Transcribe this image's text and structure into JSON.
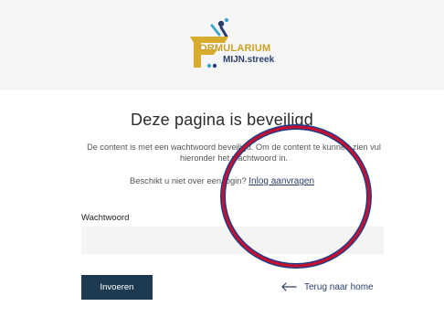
{
  "header": {
    "logo": {
      "icon": "formularium-mascot-logo-icon",
      "line1": "ORMULARIUM",
      "line2": "MIJN.streek"
    }
  },
  "main": {
    "title": "Deze pagina is beveiligd",
    "intro": "De content is met een wachtwoord beveiligd. Om de content te kunnen zien vul hieronder het wachtwoord in.",
    "login_prompt": "Beschikt u niet over een login?",
    "login_link": "Inlog aanvragen",
    "password_label": "Wachtwoord",
    "password_value": "",
    "submit_label": "Invoeren",
    "back_label": "Terug naar home",
    "back_icon": "arrow-left-icon"
  },
  "colors": {
    "accent": "#1e3a52",
    "logo_gold": "#c9a227",
    "logo_navy": "#2a3e6e",
    "annotation_red": "#c8102e",
    "annotation_blue": "#1f3c88"
  }
}
